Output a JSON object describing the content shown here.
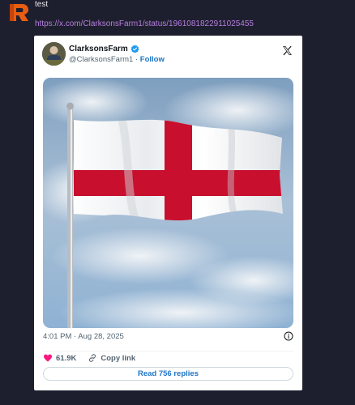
{
  "message": {
    "sender": "test",
    "link_text": "https://x.com/ClarksonsFarm1/status/1961081822911025455"
  },
  "tweet": {
    "display_name": "ClarksonsFarm",
    "handle": "@ClarksonsFarm1",
    "separator": " · ",
    "follow_label": "Follow",
    "timestamp": "4:01 PM · Aug 28, 2025",
    "likes": "61.9K",
    "copy_link_label": "Copy link",
    "replies_label": "Read 756 replies"
  },
  "colors": {
    "background": "#1e1f2e",
    "link": "#b77ee0",
    "accent": "#1d74c4",
    "like": "#f91880",
    "flag_red": "#c8102e"
  },
  "icons": [
    "r-logo-icon",
    "verified-badge-icon",
    "x-logo-icon",
    "info-icon",
    "heart-icon",
    "link-icon"
  ]
}
